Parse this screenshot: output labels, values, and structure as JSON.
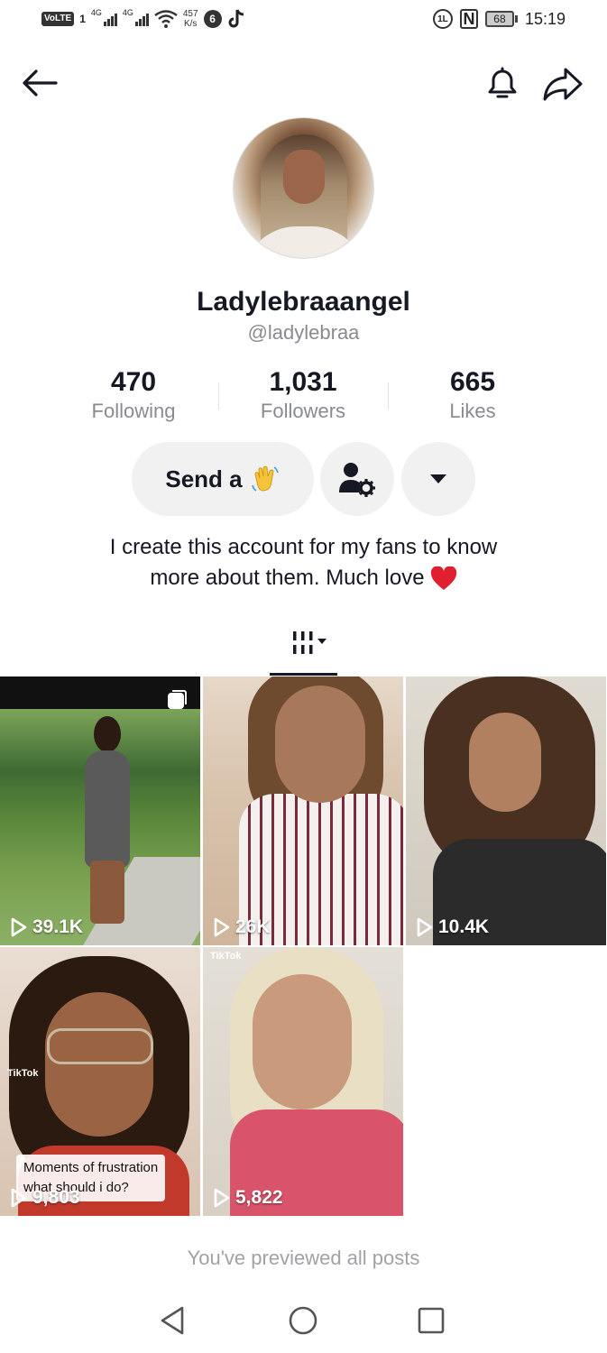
{
  "status_bar": {
    "volte": "VoLTE",
    "sim": "1",
    "net1": "4G",
    "net2": "4G",
    "speed_value": "457",
    "speed_unit": "K/s",
    "battery": "68",
    "time": "15:19"
  },
  "profile": {
    "display_name": "Ladylebraaangel",
    "username": "@ladylebraa"
  },
  "stats": [
    {
      "value": "470",
      "label": "Following"
    },
    {
      "value": "1,031",
      "label": "Followers"
    },
    {
      "value": "665",
      "label": "Likes"
    }
  ],
  "actions": {
    "send_label": "Send a"
  },
  "bio": {
    "line1": "I create this account for my fans to know",
    "line2": "more about them. Much love"
  },
  "videos": [
    {
      "views": "39.1K"
    },
    {
      "views": "26K"
    },
    {
      "views": "10.4K"
    },
    {
      "views": "9,803",
      "caption_line1": "Moments of frustration",
      "caption_line2": "what should i do?",
      "watermark": "TikTok"
    },
    {
      "views": "5,822",
      "watermark": "TikTok"
    }
  ],
  "footer": {
    "end_note": "You've previewed all posts"
  },
  "colors": {
    "text_primary": "#161823",
    "text_secondary": "#8a8b91",
    "button_bg": "#f1f1f2",
    "heart": "#e0202e"
  }
}
